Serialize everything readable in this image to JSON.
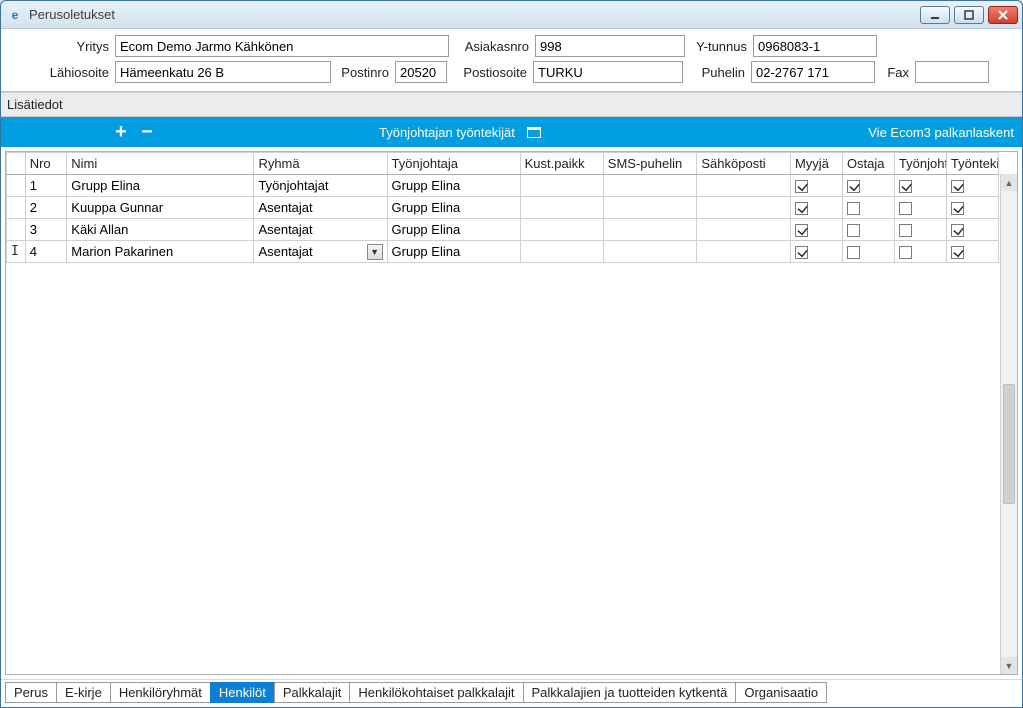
{
  "window": {
    "title": "Perusoletukset"
  },
  "form": {
    "yritys_label": "Yritys",
    "yritys": "Ecom Demo Jarmo Kähkönen",
    "asiakasnro_label": "Asiakasnro",
    "asiakasnro": "998",
    "ytunnus_label": "Y-tunnus",
    "ytunnus": "0968083-1",
    "lahiosoite_label": "Lähiosoite",
    "lahiosoite": "Hämeenkatu 26 B",
    "postinro_label": "Postinro",
    "postinro": "20520",
    "postiosoite_label": "Postiosoite",
    "postiosoite": "TURKU",
    "puhelin_label": "Puhelin",
    "puhelin": "02-2767 171",
    "fax_label": "Fax",
    "fax": ""
  },
  "section": {
    "lisatiedot": "Lisätiedot"
  },
  "toolbar": {
    "center_label": "Työnjohtajan työntekijät",
    "right_link": "Vie Ecom3 palkanlaskent"
  },
  "grid": {
    "headers": {
      "nro": "Nro",
      "nimi": "Nimi",
      "ryhma": "Ryhmä",
      "tyonjohtaja": "Työnjohtaja",
      "kust": "Kust.paikk",
      "sms": "SMS-puhelin",
      "sahko": "Sähköposti",
      "myyja": "Myyjä",
      "ostaja": "Ostaja",
      "tyonjoht": "Työnjoht",
      "tyontekija": "Työntekijä"
    },
    "rows": [
      {
        "nro": "1",
        "nimi": "Grupp Elina",
        "ryhma": "Työnjohtajat",
        "tyonjohtaja": "Grupp Elina",
        "kust": "",
        "sms": "",
        "sahko": "",
        "myyja": true,
        "ostaja": true,
        "tyonjoht": true,
        "tyontekija": true,
        "editing": false,
        "cursor": false
      },
      {
        "nro": "2",
        "nimi": "Kuuppa Gunnar",
        "ryhma": "Asentajat",
        "tyonjohtaja": "Grupp Elina",
        "kust": "",
        "sms": "",
        "sahko": "",
        "myyja": true,
        "ostaja": false,
        "tyonjoht": false,
        "tyontekija": true,
        "editing": false,
        "cursor": false
      },
      {
        "nro": "3",
        "nimi": "Käki Allan",
        "ryhma": "Asentajat",
        "tyonjohtaja": "Grupp Elina",
        "kust": "",
        "sms": "",
        "sahko": "",
        "myyja": true,
        "ostaja": false,
        "tyonjoht": false,
        "tyontekija": true,
        "editing": false,
        "cursor": false
      },
      {
        "nro": "4",
        "nimi": "Marion Pakarinen",
        "ryhma": "Asentajat",
        "tyonjohtaja": "Grupp Elina",
        "kust": "",
        "sms": "",
        "sahko": "",
        "myyja": true,
        "ostaja": false,
        "tyonjoht": false,
        "tyontekija": true,
        "editing": true,
        "cursor": true
      }
    ]
  },
  "tabs": {
    "items": [
      {
        "label": "Perus",
        "active": false
      },
      {
        "label": "E-kirje",
        "active": false
      },
      {
        "label": "Henkilöryhmät",
        "active": false
      },
      {
        "label": "Henkilöt",
        "active": true
      },
      {
        "label": "Palkkalajit",
        "active": false
      },
      {
        "label": "Henkilökohtaiset palkkalajit",
        "active": false
      },
      {
        "label": "Palkkalajien ja tuotteiden kytkentä",
        "active": false
      },
      {
        "label": "Organisaatio",
        "active": false
      }
    ]
  }
}
